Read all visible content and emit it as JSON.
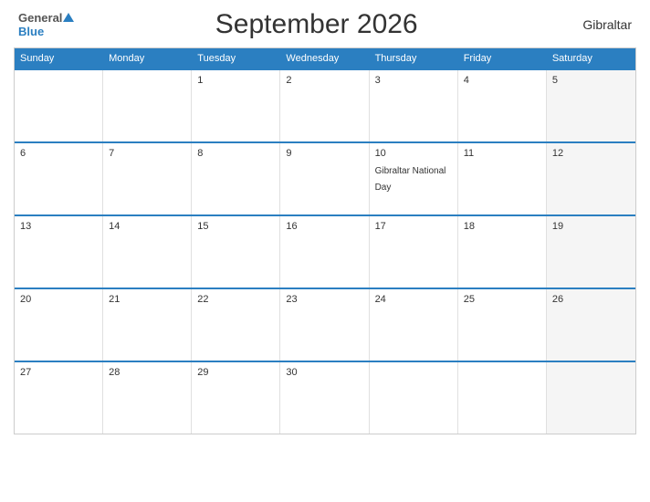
{
  "header": {
    "logo_general": "General",
    "logo_blue": "Blue",
    "title": "September 2026",
    "country": "Gibraltar"
  },
  "days_of_week": [
    "Sunday",
    "Monday",
    "Tuesday",
    "Wednesday",
    "Thursday",
    "Friday",
    "Saturday"
  ],
  "weeks": [
    [
      {
        "date": "",
        "event": "",
        "gray": false
      },
      {
        "date": "",
        "event": "",
        "gray": false
      },
      {
        "date": "1",
        "event": "",
        "gray": false
      },
      {
        "date": "2",
        "event": "",
        "gray": false
      },
      {
        "date": "3",
        "event": "",
        "gray": false
      },
      {
        "date": "4",
        "event": "",
        "gray": false
      },
      {
        "date": "5",
        "event": "",
        "gray": true
      }
    ],
    [
      {
        "date": "6",
        "event": "",
        "gray": false
      },
      {
        "date": "7",
        "event": "",
        "gray": false
      },
      {
        "date": "8",
        "event": "",
        "gray": false
      },
      {
        "date": "9",
        "event": "",
        "gray": false
      },
      {
        "date": "10",
        "event": "Gibraltar National Day",
        "gray": false
      },
      {
        "date": "11",
        "event": "",
        "gray": false
      },
      {
        "date": "12",
        "event": "",
        "gray": true
      }
    ],
    [
      {
        "date": "13",
        "event": "",
        "gray": false
      },
      {
        "date": "14",
        "event": "",
        "gray": false
      },
      {
        "date": "15",
        "event": "",
        "gray": false
      },
      {
        "date": "16",
        "event": "",
        "gray": false
      },
      {
        "date": "17",
        "event": "",
        "gray": false
      },
      {
        "date": "18",
        "event": "",
        "gray": false
      },
      {
        "date": "19",
        "event": "",
        "gray": true
      }
    ],
    [
      {
        "date": "20",
        "event": "",
        "gray": false
      },
      {
        "date": "21",
        "event": "",
        "gray": false
      },
      {
        "date": "22",
        "event": "",
        "gray": false
      },
      {
        "date": "23",
        "event": "",
        "gray": false
      },
      {
        "date": "24",
        "event": "",
        "gray": false
      },
      {
        "date": "25",
        "event": "",
        "gray": false
      },
      {
        "date": "26",
        "event": "",
        "gray": true
      }
    ],
    [
      {
        "date": "27",
        "event": "",
        "gray": false
      },
      {
        "date": "28",
        "event": "",
        "gray": false
      },
      {
        "date": "29",
        "event": "",
        "gray": false
      },
      {
        "date": "30",
        "event": "",
        "gray": false
      },
      {
        "date": "",
        "event": "",
        "gray": false
      },
      {
        "date": "",
        "event": "",
        "gray": false
      },
      {
        "date": "",
        "event": "",
        "gray": true
      }
    ]
  ]
}
